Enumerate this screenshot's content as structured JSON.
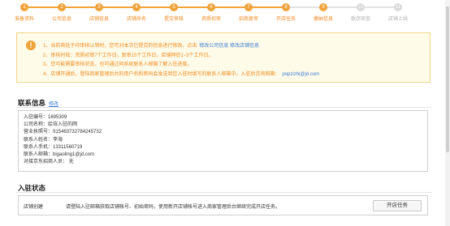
{
  "steps": [
    {
      "n": "1",
      "label": "准备资料",
      "done": true
    },
    {
      "n": "2",
      "label": "公司信息",
      "done": true
    },
    {
      "n": "3",
      "label": "店铺信息",
      "done": true
    },
    {
      "n": "4",
      "label": "店铺命名",
      "done": true
    },
    {
      "n": "5",
      "label": "提交审核",
      "done": true
    },
    {
      "n": "6",
      "label": "资质初审",
      "done": true
    },
    {
      "n": "7",
      "label": "招商复审",
      "done": true
    },
    {
      "n": "8",
      "label": "开店任务",
      "done": true
    },
    {
      "n": "9",
      "label": "缴纳信息",
      "done": true
    },
    {
      "n": "10",
      "label": "致怨审查",
      "done": false
    },
    {
      "n": "11",
      "label": "店铺上线",
      "done": false
    }
  ],
  "notice": {
    "icon": "!",
    "lines": [
      {
        "text": "1、当前商处于待审核认领时，您可对本次已提交的信息进行修改，点击",
        "link": "修改公司信息  修改店铺信息"
      },
      {
        "text": "2、审核时效：资质初审7个工作日，复审15个工作日，店铺押后1~3个工作日。",
        "link": ""
      },
      {
        "text": "3、您可能需要审核状态，也可通过同系统联系人邮箱了解入驻进度。",
        "link": ""
      },
      {
        "text": "4、店铺开通后，登陆商家管理后台的用户名和密码会发送到您入驻时填写的联系人邮箱中，入驻后咨询邮箱：",
        "link": "popzizhi@jd.com"
      }
    ]
  },
  "contact": {
    "title": "联系信息",
    "edit": "修改",
    "rows": [
      "入驻编号：1695309",
      "公司名称：绘培入驻的网",
      "营业执照号：915463732784245732",
      "联系人姓名：李海",
      "联系人手机：13311560719",
      "联系人邮箱：bigaoling1@jd.com",
      "对接京东招商人员：  无"
    ]
  },
  "status": {
    "title": "入驻状态",
    "label": "店铺创建",
    "desc": "请登陆入驻邮箱获取店铺帐号、初始密码，使用新开店铺帐号进入商家管理后台继续完成开店任务。",
    "button": "开店任务"
  },
  "colors": {
    "accent": "#f0a33a",
    "link": "#3a7bd5",
    "notice_bg": "#fffbe9"
  }
}
